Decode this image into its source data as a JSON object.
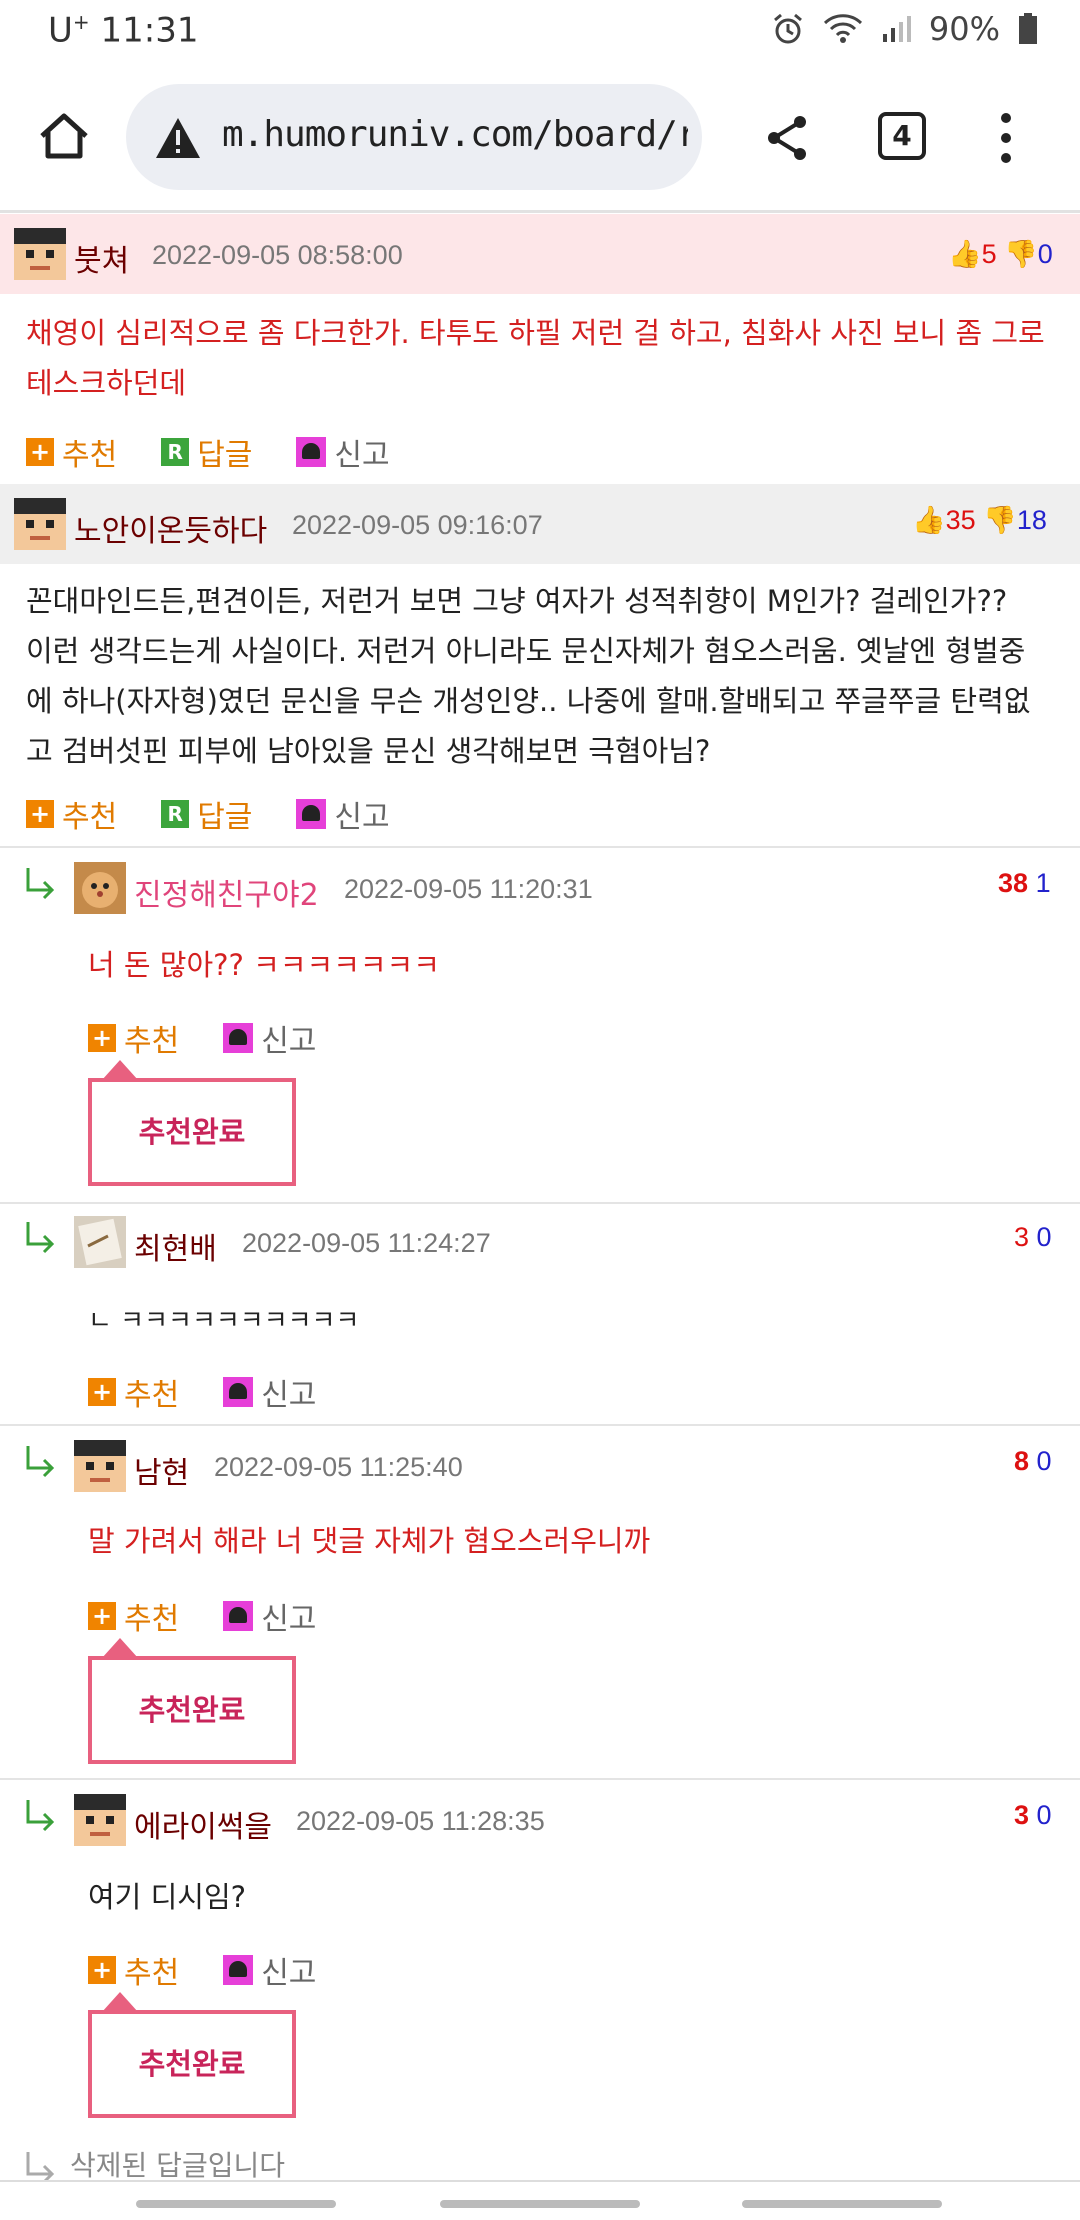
{
  "status_bar": {
    "carrier": "U",
    "carrier_sup": "+",
    "time": "11:31",
    "battery": "90%"
  },
  "browser": {
    "url": "m.humoruniv.com/board/re",
    "tab_count": "4",
    "icons": [
      "home-icon",
      "warning-icon",
      "share-icon",
      "tabs-icon",
      "more-icon"
    ]
  },
  "comments": [
    {
      "nick": "붓쳐",
      "date": "2022-09-05 08:58:00",
      "up": "5",
      "down": "0",
      "lines": [
        "채영이 심리적으로 좀 다크한가. 타투도 하필 저런 걸 하고, 침화사 사진 보니 좀 그로",
        "테스크하던데"
      ],
      "actions": {
        "recommend": "추천",
        "reply": "답글",
        "report": "신고"
      }
    },
    {
      "nick": "노안이온듯하다",
      "date": "2022-09-05 09:16:07",
      "up": "35",
      "down": "18",
      "lines": [
        "꼰대마인드든,편견이든, 저런거 보면 그냥 여자가 성적취향이 M인가? 걸레인가??",
        "이런 생각드는게 사실이다. 저런거 아니라도 문신자체가 혐오스러움. 옛날엔 형벌중",
        "에 하나(자자형)였던 문신을 무슨 개성인양.. 나중에 할매.할배되고 쭈글쭈글 탄력없",
        "고 검버섯핀 피부에 남아있을 문신 생각해보면 극혐아님?"
      ],
      "actions": {
        "recommend": "추천",
        "reply": "답글",
        "report": "신고"
      }
    }
  ],
  "replies": [
    {
      "nick": "진정해친구야2",
      "date": "2022-09-05 11:20:31",
      "up": "38",
      "down": "1",
      "text": "너 돈 많아?? ㅋㅋㅋㅋㅋㅋㅋ",
      "recommend": "추천",
      "report": "신고",
      "rec_done": "추천완료"
    },
    {
      "nick": "최현배",
      "date": "2022-09-05 11:24:27",
      "up": "3",
      "down": "0",
      "text": "ㄴ ㅋㅋㅋㅋㅋㅋㅋㅋㅋㅋ",
      "recommend": "추천",
      "report": "신고"
    },
    {
      "nick": "남현",
      "date": "2022-09-05 11:25:40",
      "up": "8",
      "down": "0",
      "text": "말 가려서 해라 너 댓글 자체가 혐오스러우니까",
      "recommend": "추천",
      "report": "신고",
      "rec_done": "추천완료"
    },
    {
      "nick": "에라이썩을",
      "date": "2022-09-05 11:28:35",
      "up": "3",
      "down": "0",
      "text": "여기 디시임?",
      "recommend": "추천",
      "report": "신고",
      "rec_done": "추천완료"
    }
  ],
  "deleted_reply": "삭제된 답글입니다"
}
